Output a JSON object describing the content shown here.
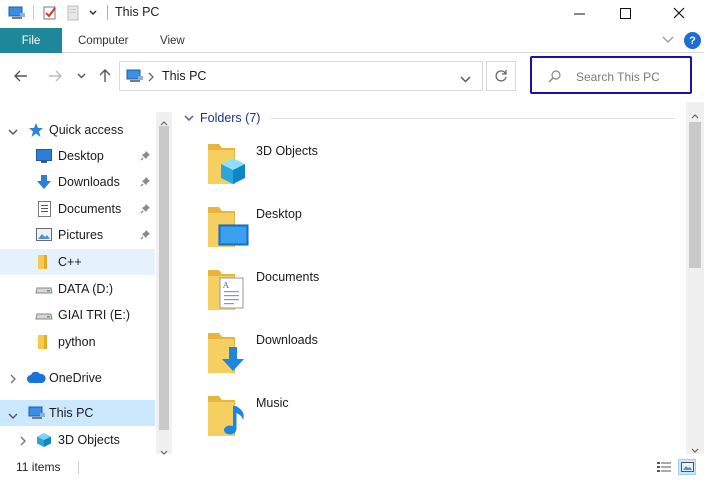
{
  "window": {
    "title": "This PC"
  },
  "ribbon": {
    "tabs": [
      {
        "label": "File"
      },
      {
        "label": "Computer"
      },
      {
        "label": "View"
      }
    ],
    "help_label": "?"
  },
  "address": {
    "path": "This PC",
    "search_placeholder": "Search This PC"
  },
  "nav": {
    "items": [
      {
        "label": "Quick access",
        "icon": "star-icon"
      },
      {
        "label": "Desktop",
        "icon": "desktop-icon",
        "pinned": true
      },
      {
        "label": "Downloads",
        "icon": "download-arrow-icon",
        "pinned": true
      },
      {
        "label": "Documents",
        "icon": "documents-icon",
        "pinned": true
      },
      {
        "label": "Pictures",
        "icon": "pictures-icon",
        "pinned": true
      },
      {
        "label": "C++",
        "icon": "folder-icon"
      },
      {
        "label": "DATA (D:)",
        "icon": "drive-icon"
      },
      {
        "label": "GIAI TRI (E:)",
        "icon": "drive-icon"
      },
      {
        "label": "python",
        "icon": "folder-icon"
      },
      {
        "label": "OneDrive",
        "icon": "cloud-icon"
      },
      {
        "label": "This PC",
        "icon": "computer-icon"
      },
      {
        "label": "3D Objects",
        "icon": "cube-icon"
      }
    ]
  },
  "content": {
    "group_title": "Folders (7)",
    "folders": [
      {
        "label": "3D Objects",
        "icon": "cube-folder-icon"
      },
      {
        "label": "Desktop",
        "icon": "desktop-folder-icon"
      },
      {
        "label": "Documents",
        "icon": "documents-folder-icon"
      },
      {
        "label": "Downloads",
        "icon": "downloads-folder-icon"
      },
      {
        "label": "Music",
        "icon": "music-folder-icon"
      }
    ]
  },
  "status": {
    "item_count": "11 items"
  },
  "colors": {
    "file_tab": "#1e8799",
    "search_outline": "#1a13a8",
    "folder_yellow": "#f5c94b",
    "accent_blue": "#1c6fd1",
    "selection": "#cce8ff",
    "group_title": "#1e3287"
  }
}
